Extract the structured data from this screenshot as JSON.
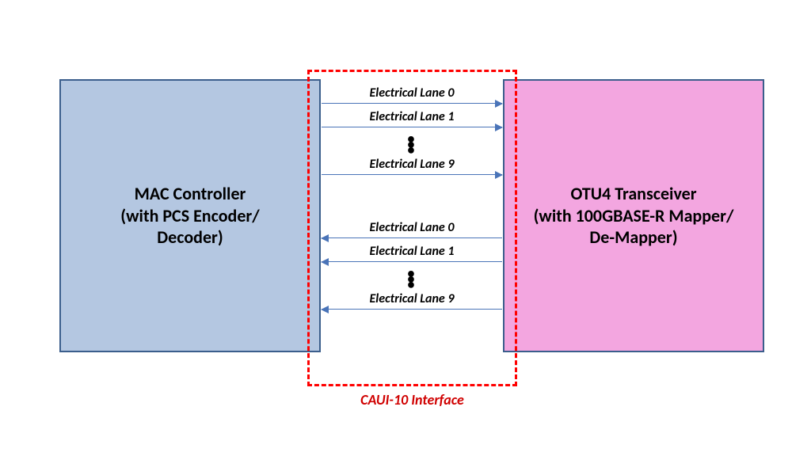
{
  "left_block": {
    "line1": "MAC Controller",
    "line2": "(with PCS Encoder/",
    "line3": "Decoder)"
  },
  "right_block": {
    "line1": "OTU4 Transceiver",
    "line2": "(with 100GBASE-R Mapper/",
    "line3": "De-Mapper)"
  },
  "interface_label": "CAUI-10 Interface",
  "forward_lanes": {
    "lane0": "Electrical Lane 0",
    "lane1": "Electrical Lane 1",
    "lane9": "Electrical Lane 9"
  },
  "reverse_lanes": {
    "lane0": "Electrical Lane 0",
    "lane1": "Electrical Lane 1",
    "lane9": "Electrical Lane 9"
  },
  "ellipsis": "•\n•\n•"
}
